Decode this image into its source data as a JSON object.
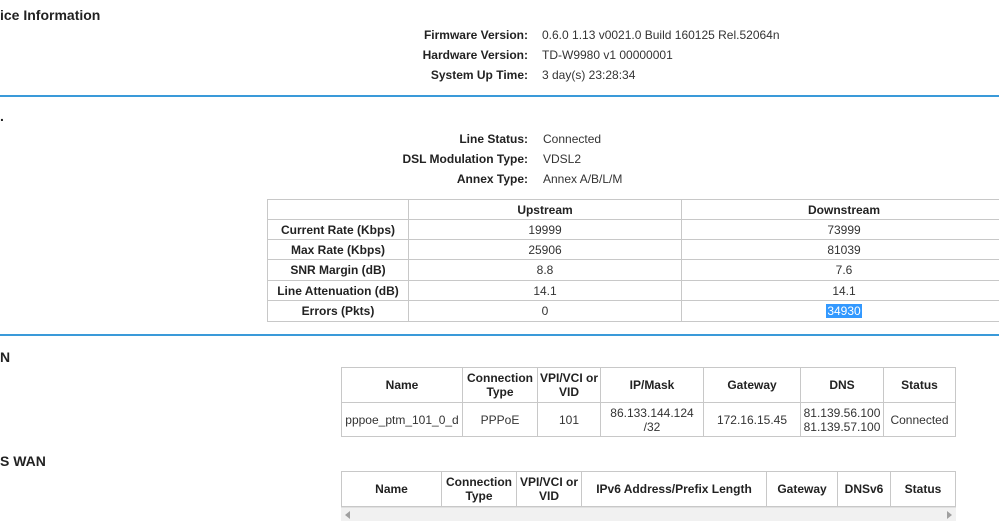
{
  "device_info": {
    "title": "ice Information",
    "firmware_label": "Firmware Version:",
    "firmware_value": "0.6.0 1.13 v0021.0 Build 160125 Rel.52064n",
    "hardware_label": "Hardware Version:",
    "hardware_value": "TD-W9980 v1 00000001",
    "uptime_label": "System Up Time:",
    "uptime_value": "3 day(s) 23:28:34"
  },
  "dsl": {
    "title": ".",
    "line_status_label": "Line Status:",
    "line_status_value": "Connected",
    "modulation_label": "DSL Modulation Type:",
    "modulation_value": "VDSL2",
    "annex_label": "Annex Type:",
    "annex_value": "Annex A/B/L/M",
    "table": {
      "headers": [
        "",
        "Upstream",
        "Downstream"
      ],
      "rows": [
        {
          "label": "Current Rate (Kbps)",
          "up": "19999",
          "down": "73999"
        },
        {
          "label": "Max Rate (Kbps)",
          "up": "25906",
          "down": "81039"
        },
        {
          "label": "SNR Margin (dB)",
          "up": "8.8",
          "down": "7.6"
        },
        {
          "label": "Line Attenuation (dB)",
          "up": "14.1",
          "down": "14.1"
        },
        {
          "label": "Errors (Pkts)",
          "up": "0",
          "down": "34930"
        }
      ]
    }
  },
  "wan": {
    "title": "N",
    "headers": {
      "name": "Name",
      "conn_type": "Connection Type",
      "vpi": "VPI/VCI or VID",
      "ip": "IP/Mask",
      "gateway": "Gateway",
      "dns": "DNS",
      "status": "Status"
    },
    "row": {
      "name": "pppoe_ptm_101_0_d",
      "conn_type": "PPPoE",
      "vpi": "101",
      "ip": "86.133.144.124 /32",
      "gateway": "172.16.15.45",
      "dns1": "81.139.56.100",
      "dns2": "81.139.57.100",
      "status": "Connected"
    }
  },
  "ipv6_wan": {
    "title": "S WAN",
    "headers": {
      "name": "Name",
      "conn_type": "Connection Type",
      "vpi": "VPI/VCI or VID",
      "addr": "IPv6 Address/Prefix Length",
      "gateway": "Gateway",
      "dns": "DNSv6",
      "status": "Status"
    }
  },
  "colors": {
    "divider": "#3a9ad9",
    "selection": "#3399ff"
  }
}
